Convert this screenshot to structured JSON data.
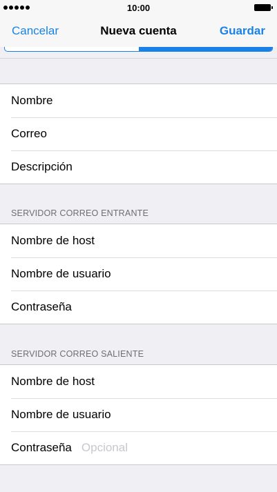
{
  "status_bar": {
    "time": "10:00"
  },
  "nav": {
    "cancel": "Cancelar",
    "title": "Nueva cuenta",
    "save": "Guardar"
  },
  "account": {
    "rows": [
      {
        "label": "Nombre"
      },
      {
        "label": "Correo"
      },
      {
        "label": "Descripción"
      }
    ]
  },
  "incoming": {
    "header": "SERVIDOR CORREO ENTRANTE",
    "rows": [
      {
        "label": "Nombre de host"
      },
      {
        "label": "Nombre de usuario"
      },
      {
        "label": "Contraseña"
      }
    ]
  },
  "outgoing": {
    "header": "SERVIDOR CORREO SALIENTE",
    "rows": [
      {
        "label": "Nombre de host"
      },
      {
        "label": "Nombre de usuario"
      },
      {
        "label": "Contraseña",
        "placeholder": "Opcional"
      }
    ]
  }
}
